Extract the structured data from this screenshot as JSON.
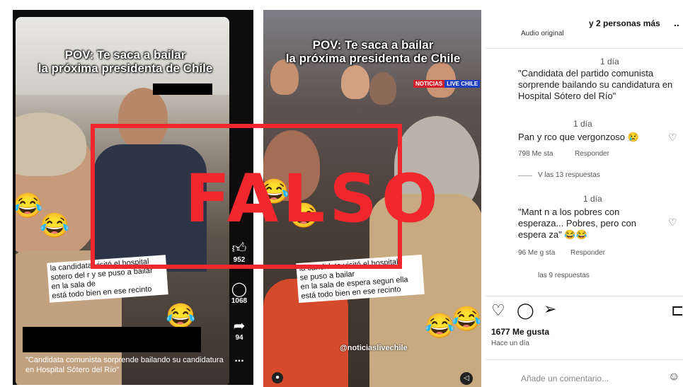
{
  "left_video": {
    "title_line1": "POV: Te saca a bailar",
    "title_line2": "la próxima presidenta de Chile",
    "caption_lines": [
      "la candidata visitó el hospital",
      "sotero del r  y se puso a bailar",
      "en la sala de   ",
      "está todo bien en ese recinto"
    ],
    "like_count": "952",
    "comment_count": "1068",
    "share_count": "94",
    "more_label": "...",
    "bottom_caption": "\"Candidata comunista sorprende bailando su candidatura en Hospital Sótero del Río\"",
    "emoji": "😂"
  },
  "middle_video": {
    "title_line1": "POV: Te saca a bailar",
    "title_line2": "la próxima presidenta de Chile",
    "news_badge_1": "NOTICIAS",
    "news_badge_2": "LIVE CHILE",
    "caption_lines": [
      "la candidata visitó el hospital",
      "            se puso a bailar",
      "en la sala de espera segun ella",
      "está todo bien en ese recinto"
    ],
    "handle": "@noticiaslivechile",
    "emoji": "😂"
  },
  "comments_panel": {
    "header_others": "y 2 personas más",
    "audio_label": "Audio original",
    "menu": "..",
    "c1_time": "1 día",
    "c1_text": "\"Candidata del partido comunista sorprende bailando su candidatura en Hospital Sótero del Río\"",
    "c2_time": "1 día",
    "c2_text": "Pan y  rco que vergonzoso 😢",
    "c2_likes": "798 Me   sta",
    "c2_reply": "Responder",
    "c2_replies": "V   las 13 respuestas",
    "c3_time": "1 día",
    "c3_text": "\"Mant  n a los pobres con esperaza... Pobres, pero con espera  za\" 😂😂",
    "c3_likes": "96 Me g  sta",
    "c3_reply": "Responder",
    "c3_replies": "   las 9 respuestas",
    "likes_total": "1677 Me gusta",
    "posted": "Hace un día",
    "add_comment_placeholder": "Añade un comentario..."
  },
  "stamp_text": "FALSO",
  "colors": {
    "stamp": "#f0282d"
  }
}
